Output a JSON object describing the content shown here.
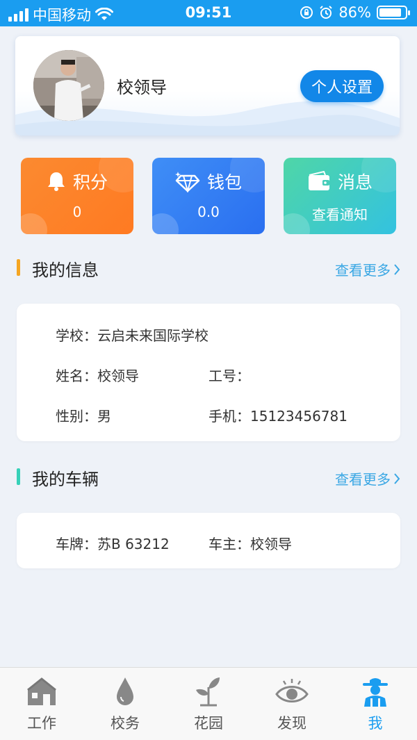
{
  "status_bar": {
    "carrier": "中国移动",
    "time": "09:51",
    "battery": "86%",
    "battery_level": 0.86
  },
  "profile": {
    "name": "校领导",
    "settings_button": "个人设置"
  },
  "tiles": {
    "points": {
      "label": "积分",
      "value": "0",
      "icon": "bell-icon"
    },
    "wallet": {
      "label": "钱包",
      "value": "0.0",
      "icon": "diamond-icon"
    },
    "messages": {
      "label": "消息",
      "value": "查看通知",
      "icon": "wallet-icon"
    }
  },
  "my_info": {
    "title": "我的信息",
    "more": "查看更多",
    "accent": "#f5a623",
    "school_label": "学校：",
    "school": "云启未来国际学校",
    "name_label": "姓名：",
    "name": "校领导",
    "job_no_label": "工号：",
    "job_no": "",
    "gender_label": "性别：",
    "gender": "男",
    "phone_label": "手机：",
    "phone": "15123456781"
  },
  "my_vehicle": {
    "title": "我的车辆",
    "more": "查看更多",
    "accent": "#36d1b8",
    "plate_label": "车牌：",
    "plate": "苏B 63212",
    "owner_label": "车主：",
    "owner": "校领导"
  },
  "tab_bar": {
    "active_color": "#1a9df0",
    "items": [
      {
        "label": "工作",
        "icon": "house-icon"
      },
      {
        "label": "校务",
        "icon": "drop-icon"
      },
      {
        "label": "花园",
        "icon": "sprout-icon"
      },
      {
        "label": "发现",
        "icon": "eye-icon"
      },
      {
        "label": "我",
        "icon": "farmer-icon"
      }
    ]
  }
}
